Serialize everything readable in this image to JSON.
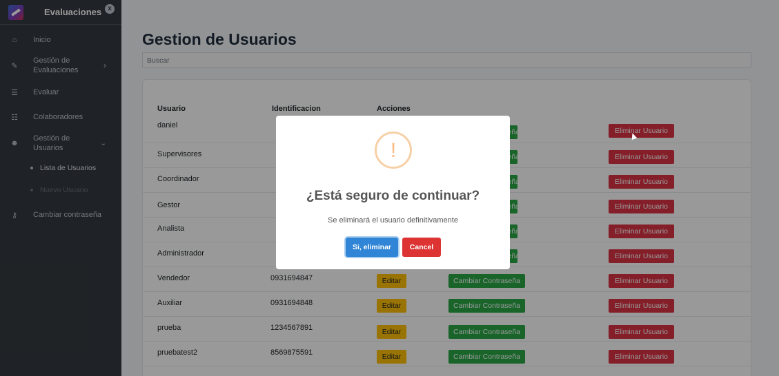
{
  "sidebar": {
    "brand": "Evaluaciones",
    "close_icon": "x",
    "items": [
      {
        "label": "Inicio",
        "icon": "home-icon"
      },
      {
        "label": "Gestión de Evaluaciones",
        "icon": "wrench-icon",
        "arrow": "›"
      },
      {
        "label": "Evaluar",
        "icon": "list-icon"
      },
      {
        "label": "Colaboradores",
        "icon": "users-icon"
      },
      {
        "label": "Gestión de Usuarios",
        "icon": "user-group-icon",
        "arrow": "⌄"
      },
      {
        "label": "Cambiar contraseña",
        "icon": "key-icon"
      }
    ],
    "subitems": [
      {
        "label": "Lista de Usuarios"
      },
      {
        "label": "Nuevo Usuario"
      }
    ]
  },
  "main": {
    "title": "Gestion de Usuarios",
    "search_placeholder": "Buscar",
    "table": {
      "headers": [
        "Usuario",
        "Identificacion",
        "Acciones"
      ],
      "rows": [
        {
          "usuario": "daniel",
          "id": ""
        },
        {
          "usuario": "Supervisores",
          "id": ""
        },
        {
          "usuario": "Coordinador",
          "id": ""
        },
        {
          "usuario": "Gestor",
          "id": ""
        },
        {
          "usuario": "Analista",
          "id": ""
        },
        {
          "usuario": "Administrador",
          "id": ""
        },
        {
          "usuario": "Vendedor",
          "id": "0931694847"
        },
        {
          "usuario": "Auxiliar",
          "id": "0931694848"
        },
        {
          "usuario": "prueba",
          "id": "1234567891"
        },
        {
          "usuario": "pruebatest2",
          "id": "8569875591"
        }
      ],
      "edit_label": "Editar",
      "pass_label": "Cambiar Contraseña",
      "pass_label_partial": "eña",
      "delete_label": "Eliminar Usuario"
    }
  },
  "modal": {
    "icon": "!",
    "title": "¿Está seguro de continuar?",
    "text": "Se eliminará el usuario definitivamente",
    "confirm_label": "Si, eliminar",
    "cancel_label": "Cancel"
  },
  "colors": {
    "sidebar": "#343a40",
    "edit": "#ffc107",
    "pass": "#28a745",
    "delete": "#dc3545",
    "confirm": "#3085d6",
    "cancel": "#dd3333"
  }
}
